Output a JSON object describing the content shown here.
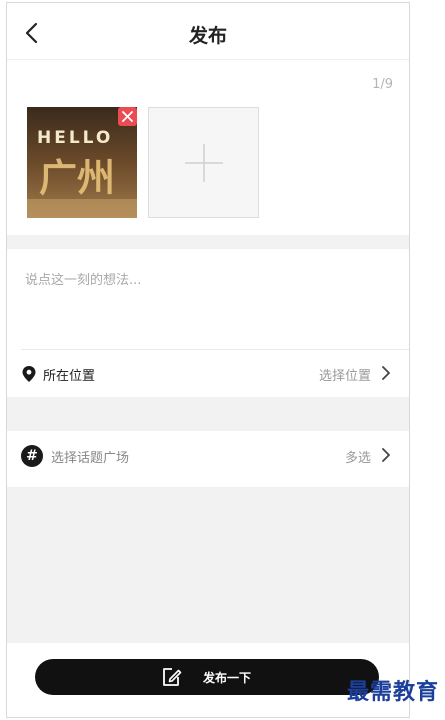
{
  "header": {
    "title": "发布"
  },
  "photos": {
    "count_label": "1/9",
    "items": [
      {
        "caption_top": "HELLO",
        "caption_main": "广州"
      }
    ]
  },
  "compose": {
    "placeholder": "说点这一刻的想法..."
  },
  "location": {
    "label": "所在位置",
    "value": "选择位置"
  },
  "topic": {
    "label": "选择话题广场",
    "value": "多选"
  },
  "publish": {
    "label": "发布一下"
  },
  "watermark": {
    "text": "最需教育"
  },
  "colors": {
    "accent": "#111111",
    "remove": "#e94c52",
    "watermark": "#1c3f9c"
  }
}
